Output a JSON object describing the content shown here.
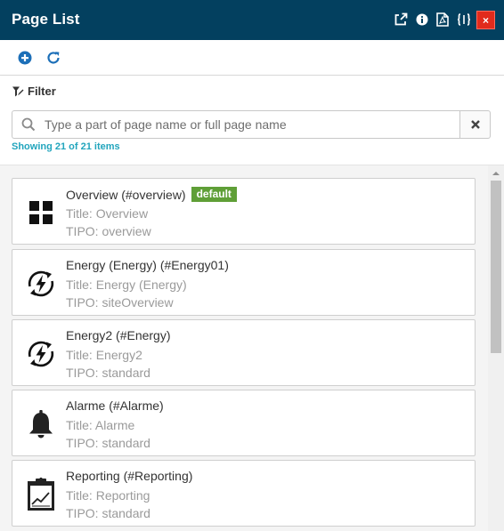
{
  "header": {
    "title": "Page List",
    "icons": [
      "external-link-icon",
      "info-icon",
      "pdf-icon",
      "code-brackets-icon"
    ],
    "close_label": "×",
    "background_color": "#03405f"
  },
  "toolbar": {
    "add_icon": "plus-circle-icon",
    "refresh_icon": "refresh-icon",
    "icon_color": "#1c6fb8"
  },
  "filter": {
    "label": "Filter",
    "search_placeholder": "Type a part of page name or full page name",
    "search_value": "",
    "clear_label": "✖",
    "count_text": "Showing 21 of 21 items"
  },
  "pages": [
    {
      "icon": "grid-icon",
      "name": "Overview (#overview)",
      "badge": "default",
      "title": "Title: Overview",
      "type": "TIPO: overview"
    },
    {
      "icon": "energy-cycle-icon",
      "name": "Energy (Energy) (#Energy01)",
      "badge": "",
      "title": "Title: Energy (Energy)",
      "type": "TIPO: siteOverview"
    },
    {
      "icon": "energy-cycle-icon",
      "name": "Energy2 (#Energy)",
      "badge": "",
      "title": "Title: Energy2",
      "type": "TIPO: standard"
    },
    {
      "icon": "bell-icon",
      "name": "Alarme (#Alarme)",
      "badge": "",
      "title": "Title: Alarme",
      "type": "TIPO: standard"
    },
    {
      "icon": "report-clipboard-icon",
      "name": "Reporting (#Reporting)",
      "badge": "",
      "title": "Title: Reporting",
      "type": "TIPO: standard"
    }
  ],
  "colors": {
    "badge": "#5f9f37",
    "count_text": "#22a5bd",
    "close": "#e12b1c"
  }
}
